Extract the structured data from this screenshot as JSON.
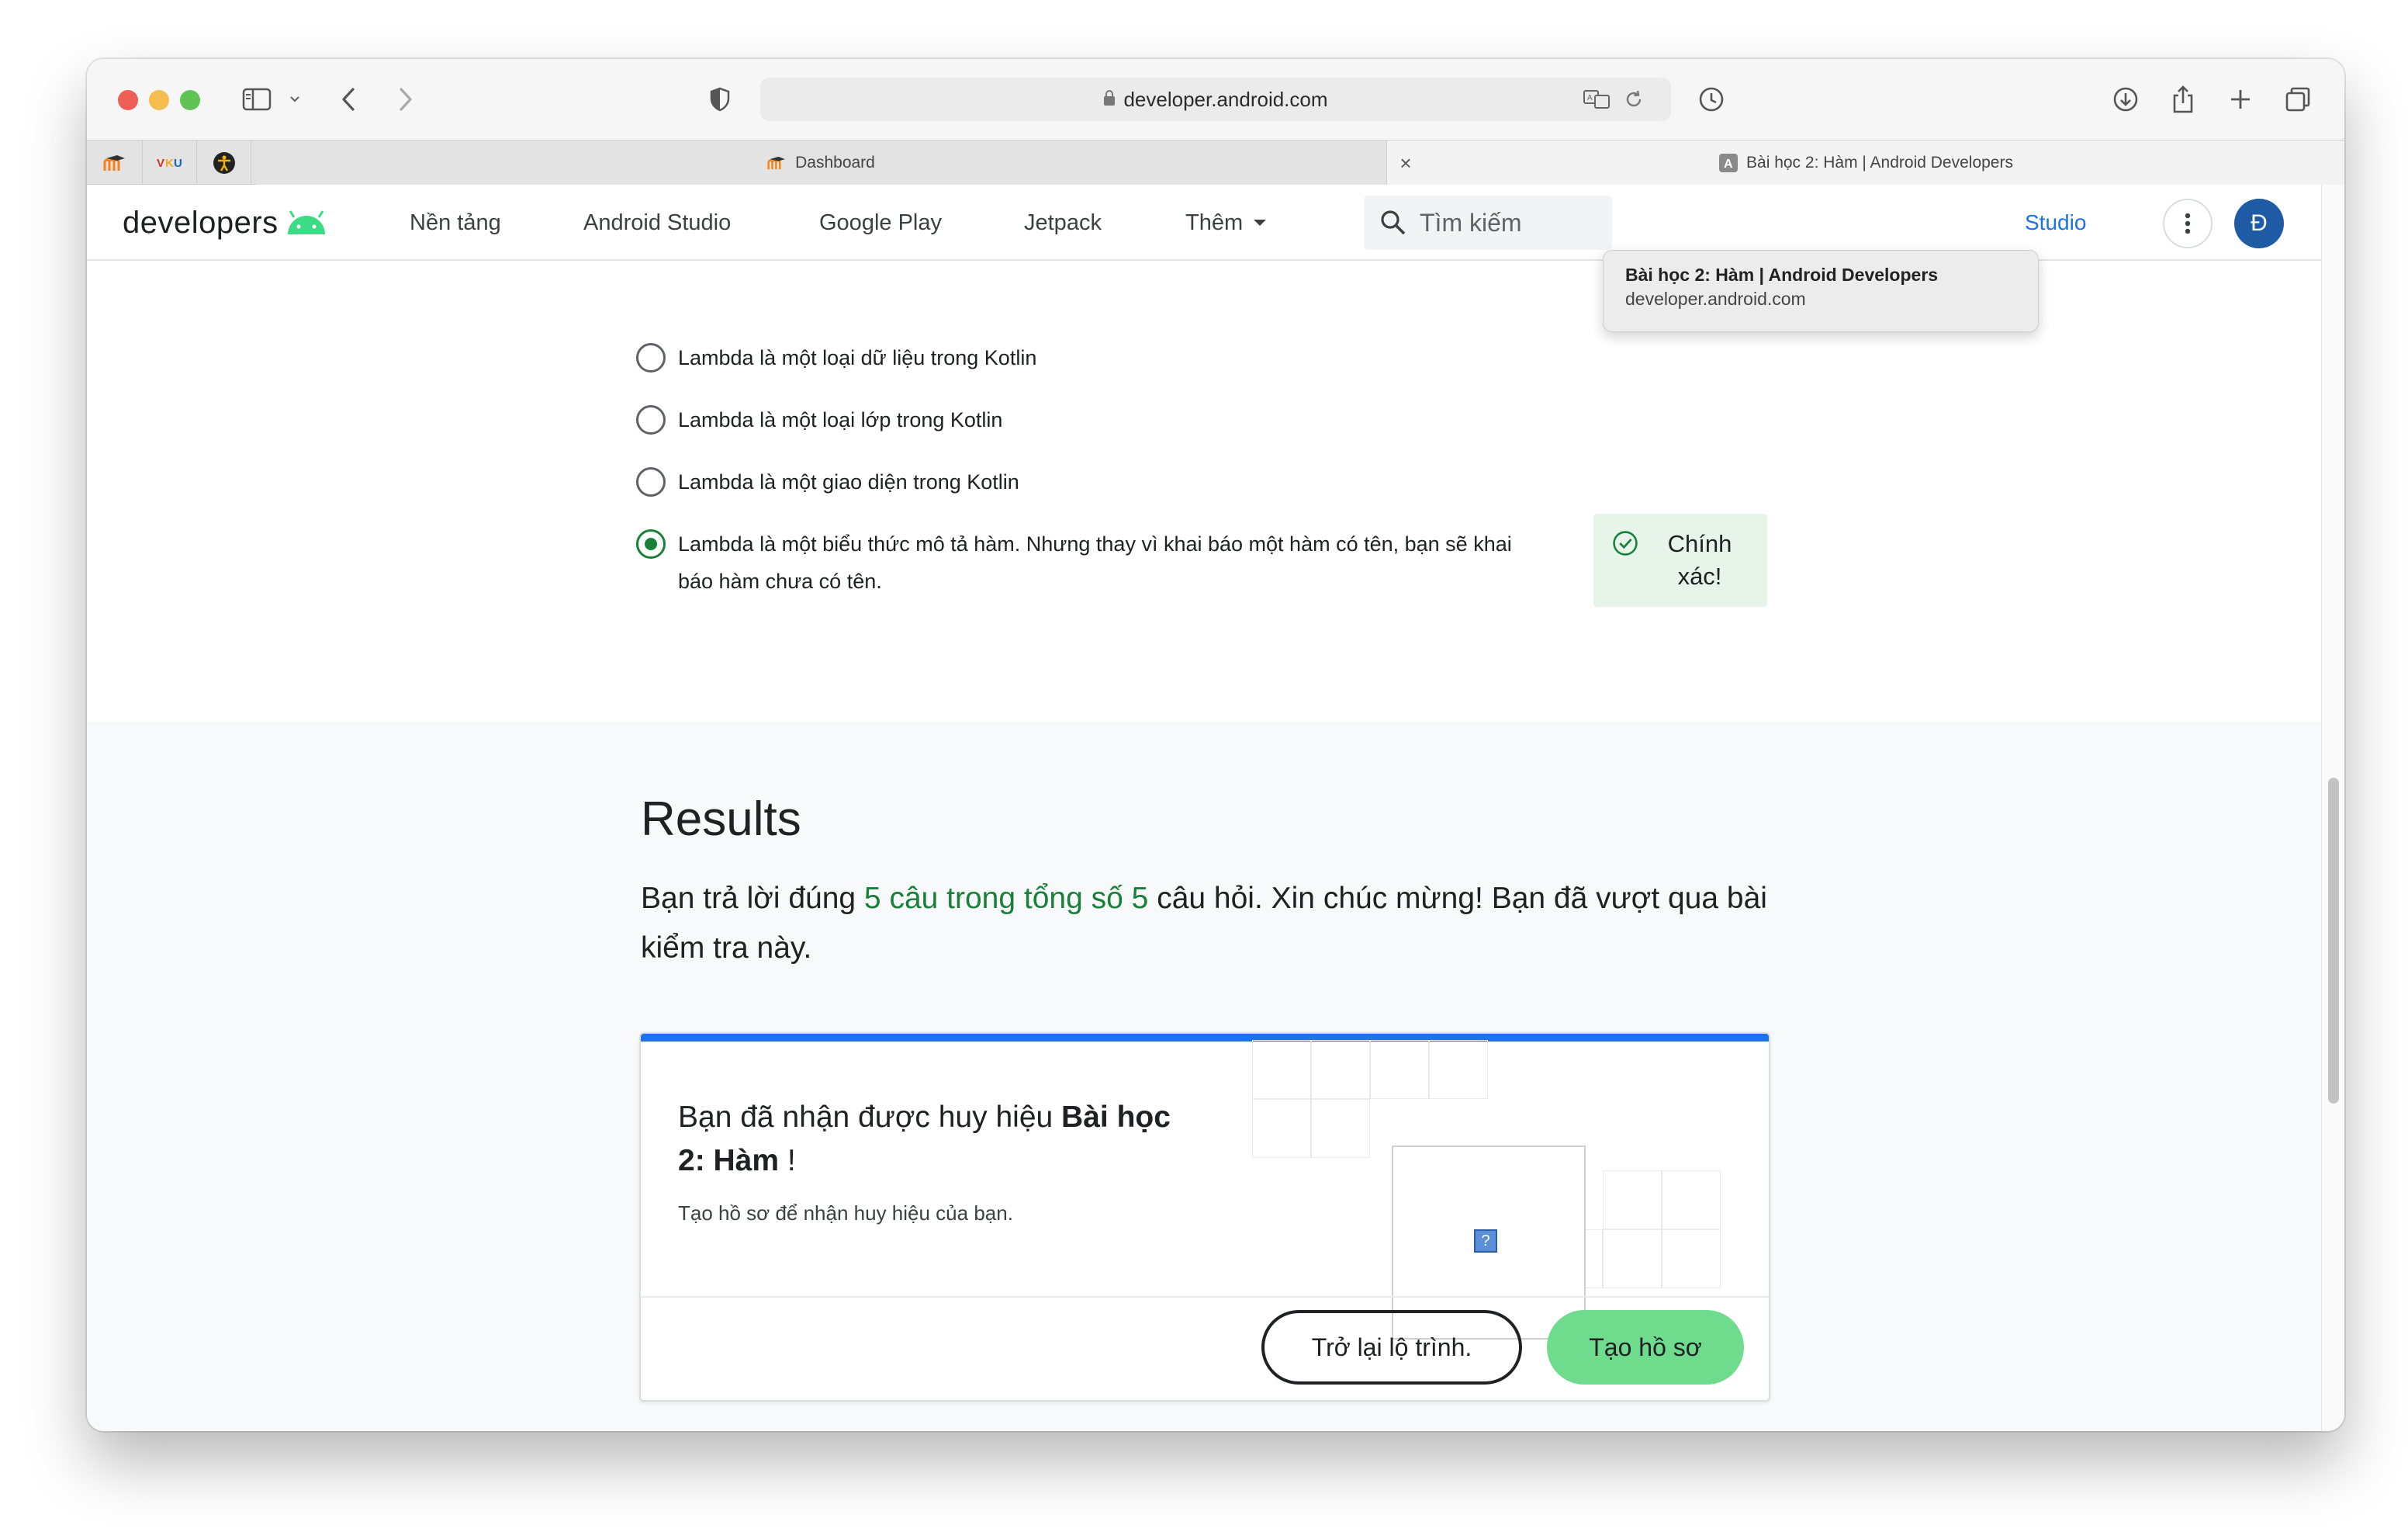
{
  "browser": {
    "url": "developer.android.com",
    "tabs": [
      {
        "label": "Dashboard"
      },
      {
        "label": "Bài học 2: Hàm  |  Android Developers"
      }
    ],
    "pinned_tabs": [
      "moodle",
      "vku",
      "accessibility"
    ],
    "tooltip": {
      "title": "Bài học 2: Hàm  |  Android Developers",
      "url": "developer.android.com"
    }
  },
  "site_nav": {
    "brand": "developers",
    "links": [
      "Nền tảng",
      "Android Studio",
      "Google Play",
      "Jetpack",
      "Thêm"
    ],
    "search_placeholder": "Tìm kiếm",
    "right_link": "Studio",
    "avatar_initial": "Đ"
  },
  "quiz": {
    "options": [
      {
        "text": "Lambda là một loại dữ liệu trong Kotlin",
        "selected": false
      },
      {
        "text": "Lambda là một loại lớp trong Kotlin",
        "selected": false
      },
      {
        "text": "Lambda là một giao diện trong Kotlin",
        "selected": false
      },
      {
        "text": "Lambda là một biểu thức mô tả hàm. Nhưng thay vì khai báo một hàm có tên, bạn sẽ khai báo hàm chưa có tên.",
        "selected": true
      }
    ],
    "feedback": "Chính xác!"
  },
  "results": {
    "title": "Results",
    "text_before": "Bạn trả lời đúng ",
    "score": "5 câu trong tổng số 5",
    "text_after": " câu hỏi. Xin chúc mừng! Bạn đã vượt qua bài kiểm tra này."
  },
  "badge_card": {
    "heading_prefix": "Bạn đã nhận được huy hiệu ",
    "badge_name": "Bài học 2: Hàm",
    "heading_suffix": " !",
    "subtext": "Tạo hồ sơ để nhận huy hiệu của bạn.",
    "badge_placeholder": "?",
    "secondary_button": "Trở lại lộ trình.",
    "primary_button": "Tạo hồ sơ"
  },
  "colors": {
    "accent_blue": "#1a73e8",
    "correct_green": "#188038",
    "button_green": "#6fdb8d",
    "avatar_blue": "#1f5aa5"
  }
}
